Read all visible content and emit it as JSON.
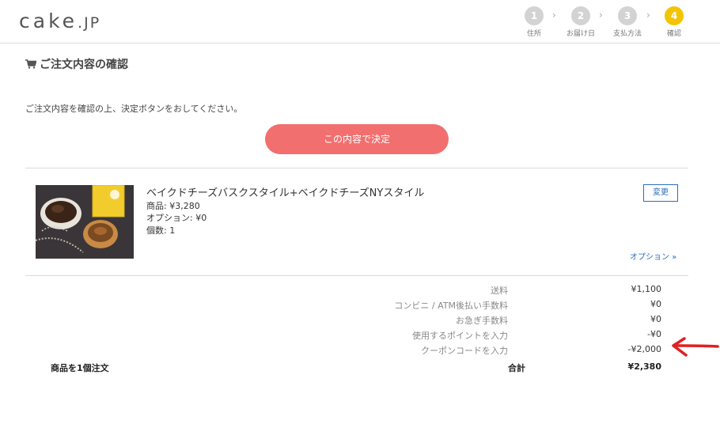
{
  "header": {
    "logo_main": "cake",
    "logo_suffix": ".JP",
    "steps": [
      {
        "num": "1",
        "label": "住所"
      },
      {
        "num": "2",
        "label": "お届け日"
      },
      {
        "num": "3",
        "label": "支払方法"
      },
      {
        "num": "4",
        "label": "確認"
      }
    ],
    "step_separator": "›"
  },
  "page": {
    "title": "ご注文内容の確認",
    "instruction": "ご注文内容を確認の上、決定ボタンをおしてください。",
    "confirm_button": "この内容で決定"
  },
  "product": {
    "name": "ベイクドチーズバスクスタイル+ベイクドチーズNYスタイル",
    "price": "商品: ¥3,280",
    "option": "オプション: ¥0",
    "quantity": "個数: 1",
    "change_button": "変更",
    "option_link": "オプション »"
  },
  "summary": {
    "rows": [
      {
        "label": "送料",
        "value": "¥1,100"
      },
      {
        "label": "コンビニ / ATM後払い手数料",
        "value": "¥0"
      },
      {
        "label": "お急ぎ手数料",
        "value": "¥0"
      },
      {
        "label": "使用するポイントを入力",
        "value": "-¥0"
      },
      {
        "label": "クーポンコードを入力",
        "value": "-¥2,000"
      }
    ],
    "item_count": "商品を1個注文",
    "total_label": "合計",
    "total_value": "¥2,380"
  },
  "colors": {
    "accent_button": "#f26f6f",
    "active_step": "#f5c400",
    "link": "#2a6ebb",
    "annotation_arrow": "#e02020"
  }
}
